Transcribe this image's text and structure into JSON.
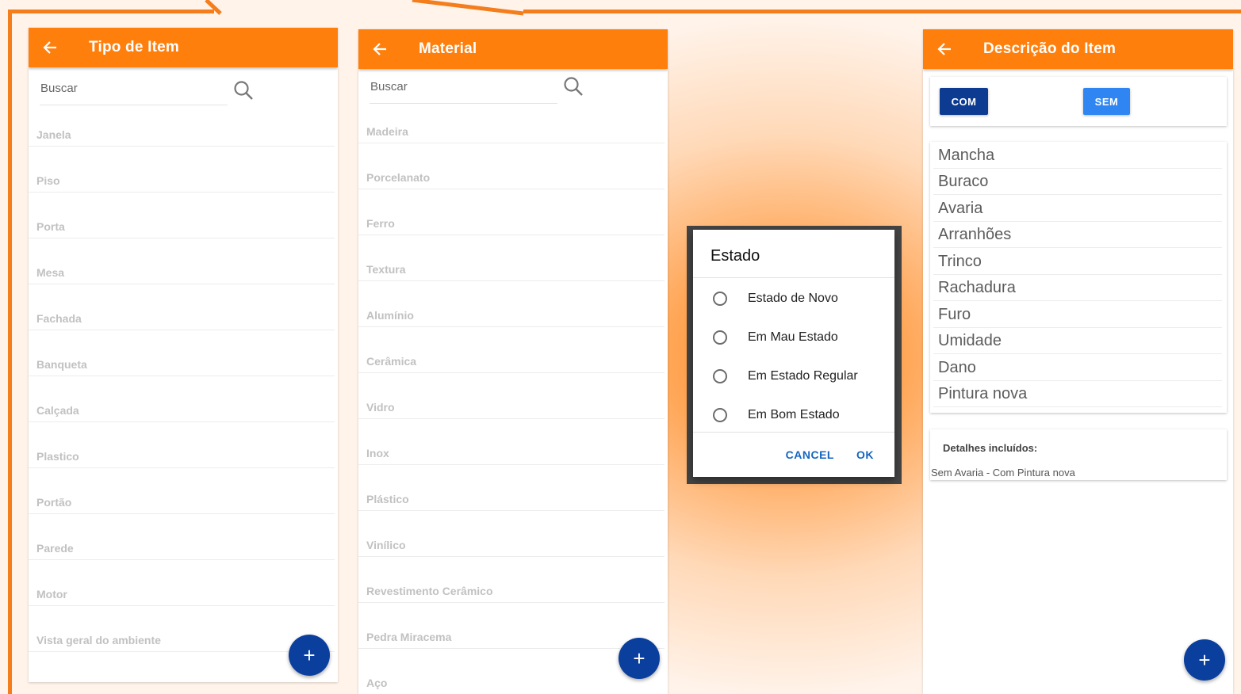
{
  "colors": {
    "accent": "#ff7f0d",
    "fab": "#0a3f9e",
    "com_button": "#0d3b91",
    "sem_button": "#2f86f3",
    "dialog_action": "#1565c0"
  },
  "panel1": {
    "title": "Tipo de Item",
    "search_placeholder": "Buscar",
    "items": [
      "Janela",
      "Piso",
      "Porta",
      "Mesa",
      "Fachada",
      "Banqueta",
      "Calçada",
      "Plastico",
      "Portão",
      "Parede",
      "Motor",
      "Vista geral do ambiente"
    ],
    "fab": "+"
  },
  "panel2": {
    "title": "Material",
    "search_placeholder": "Buscar",
    "items": [
      "Madeira",
      "Porcelanato",
      "Ferro",
      "Textura",
      "Alumínio",
      "Cerâmica",
      "Vidro",
      "Inox",
      "Plástico",
      "Vinílico",
      "Revestimento Cerâmico",
      "Pedra Miracema",
      "Aço"
    ],
    "fab": "+"
  },
  "dialog": {
    "title": "Estado",
    "options": [
      "Estado de Novo",
      "Em Mau Estado",
      "Em Estado Regular",
      "Em Bom Estado"
    ],
    "cancel": "CANCEL",
    "ok": "OK"
  },
  "panel4": {
    "title": "Descrição do Item",
    "com_label": "COM",
    "sem_label": "SEM",
    "items": [
      "Mancha",
      "Buraco",
      "Avaria",
      "Arranhões",
      "Trinco",
      "Rachadura",
      "Furo",
      "Umidade",
      "Dano",
      "Pintura nova"
    ],
    "details_label": "Detalhes incluídos:",
    "details_value": "Sem Avaria - Com Pintura nova",
    "fab": "+"
  }
}
